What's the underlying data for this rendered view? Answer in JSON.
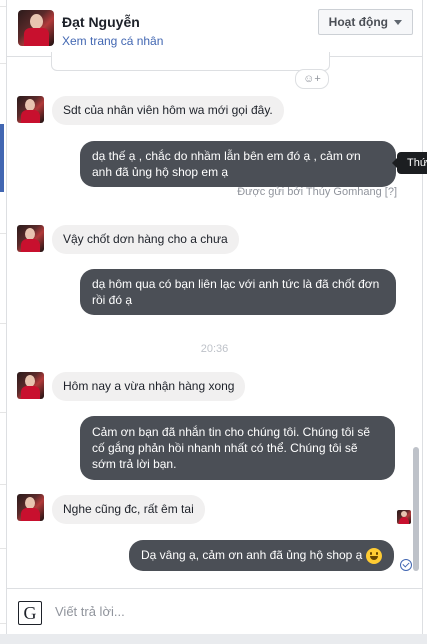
{
  "header": {
    "name": "Đạt Nguyễn",
    "profile_link": "Xem trang cá nhân",
    "status_button": "Hoạt động"
  },
  "messages": [
    {
      "direction": "in",
      "text": "Sdt của nhân viên hôm wa mới gọi đây."
    },
    {
      "direction": "out",
      "text": "dạ thế ạ , chắc do nhầm lẫn bên em đó ạ , cảm ơn anh đã ủng hộ shop em ạ"
    },
    {
      "direction": "in",
      "text": "Vậy chốt dơn hàng cho a chưa"
    },
    {
      "direction": "out",
      "text": "dạ hôm qua có bạn liên lạc với anh tức là đã chốt đơn rồi đó ạ"
    },
    {
      "direction": "in",
      "text": "Hôm nay a vừa nhận hàng xong"
    },
    {
      "direction": "out",
      "text": "Cảm ơn bạn đã nhắn tin cho chúng tôi. Chúng tôi sẽ cố gắng phản hồi nhanh nhất có thể. Chúng tôi sẽ sớm trả lời bạn."
    },
    {
      "direction": "in",
      "text": "Nghe cũng đc, rất êm tai"
    },
    {
      "direction": "out",
      "text": "Dạ vâng ạ, cảm ơn anh đã ủng hộ shop ạ"
    }
  ],
  "sent_by": "Được gửi bởi Thúy Gomhang [?]",
  "tooltip": "Thứ",
  "time_separator": "20:36",
  "composer": {
    "placeholder": "Viết trả lời..."
  },
  "icons": {
    "reaction": "add-reaction-icon",
    "gif": "gif-icon",
    "seen": "seen-check-icon",
    "emoji": "smiley-emoji-icon"
  },
  "colors": {
    "outgoing_bubble": "#4b4f56",
    "incoming_bubble": "#f1f0f0",
    "link": "#4267b2"
  }
}
